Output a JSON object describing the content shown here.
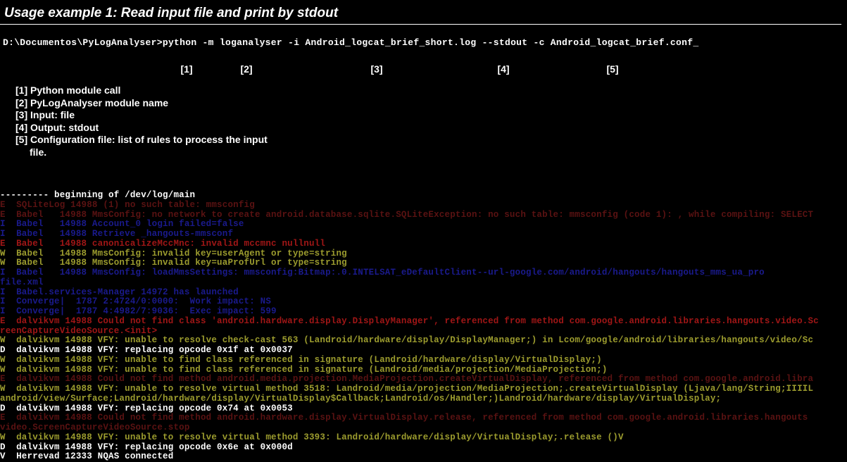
{
  "title": "Usage example 1: Read input file and print by stdout",
  "cmd": {
    "prompt": "D:\\Documentos\\PyLogAnalyser>",
    "part1": "python -m",
    "part2": "loganalyser",
    "part3": "-i Android_logcat_brief_short.log",
    "part4": "--stdout",
    "part5": "-c Android_logcat_brief.conf_"
  },
  "annot": {
    "a1": "[1]",
    "a2": "[2]",
    "a3": "[3]",
    "a4": "[4]",
    "a5": "[5]"
  },
  "legend": {
    "l1": "[1] Python module call",
    "l2": "[2] PyLogAnalyser module name",
    "l3": "[3] Input: file",
    "l4": "[4] Output: stdout",
    "l5": "[5] Configuration file: list of rules to process the input",
    "l5b": "file."
  },
  "log": [
    {
      "c": "c-white",
      "t": "--------- beginning of /dev/log/main"
    },
    {
      "c": "c-darkred",
      "t": "E  SQLiteLog 14988 (1) no such table: mmsconfig"
    },
    {
      "c": "c-darkred",
      "t": "E  Babel   14988 MmsConfig: no network to create android.database.sqlite.SQLiteException: no such table: mmsconfig (code 1): , while compiling: SELECT"
    },
    {
      "c": "c-darkblue",
      "t": "I  Babel   14988 Account_0 login failed=false"
    },
    {
      "c": "c-darkblue",
      "t": "I  Babel   14988 Retrieve _hangouts-mmsconf"
    },
    {
      "c": "c-red",
      "t": "E  Babel   14988 canonicalizeMccMnc: invalid mccmnc nullnull"
    },
    {
      "c": "c-olive",
      "t": "W  Babel   14988 MmsConfig: invalid key=userAgent or type=string"
    },
    {
      "c": "c-olive",
      "t": "W  Babel   14988 MmsConfig: invalid key=uaProfUrl or type=string"
    },
    {
      "c": "c-darkblue",
      "t": "I  Babel   14988 MmsConfig: loadMmsSettings: mmsconfig:Bitmap:.0.INTELSAT_eDefaultClient--url-google.com/android/hangouts/hangouts_mms_ua_pro"
    },
    {
      "c": "c-darkblue",
      "t": "file.xml"
    },
    {
      "c": "c-darkblue",
      "t": "I  Babel.services-Manager 14972 has launched"
    },
    {
      "c": "c-darkblue",
      "t": "I  Converge|  1787 2:4724/0:0000:  Work impact: NS"
    },
    {
      "c": "c-darkblue",
      "t": "I  Converge|  1787 4:4982/7:9036:  Exec impact: 599"
    },
    {
      "c": "c-red",
      "t": "E  dalvikvm 14988 Could not find class 'android.hardware.display.DisplayManager', referenced from method com.google.android.libraries.hangouts.video.Sc"
    },
    {
      "c": "c-red",
      "t": "reenCaptureVideoSource.<init>"
    },
    {
      "c": "c-olive",
      "t": "W  dalvikvm 14988 VFY: unable to resolve check-cast 563 (Landroid/hardware/display/DisplayManager;) in Lcom/google/android/libraries/hangouts/video/Sc"
    },
    {
      "c": "c-white",
      "t": "D  dalvikvm 14988 VFY: replacing opcode 0x1f at 0x0037"
    },
    {
      "c": "c-olive",
      "t": "W  dalvikvm 14988 VFY: unable to find class referenced in signature (Landroid/hardware/display/VirtualDisplay;)"
    },
    {
      "c": "c-olive",
      "t": "W  dalvikvm 14988 VFY: unable to find class referenced in signature (Landroid/media/projection/MediaProjection;)"
    },
    {
      "c": "c-darkred",
      "t": "E  dalvikvm 14988 Could not find method android.media.projection.MediaProjection.createVirtualDisplay, referenced from method com.google.android.libra"
    },
    {
      "c": "c-olive",
      "t": "W  dalvikvm 14988 VFY: unable to resolve virtual method 3518: Landroid/media/projection/MediaProjection;.createVirtualDisplay (Ljava/lang/String;IIIIL"
    },
    {
      "c": "c-olive",
      "t": "android/view/Surface;Landroid/hardware/display/VirtualDisplay$Callback;Landroid/os/Handler;)Landroid/hardware/display/VirtualDisplay;"
    },
    {
      "c": "c-white",
      "t": "D  dalvikvm 14988 VFY: replacing opcode 0x74 at 0x0053"
    },
    {
      "c": "c-darkred",
      "t": "E  dalvikvm 14988 Could not find method android.hardware.display.VirtualDisplay.release, referenced from method com.google.android.libraries.hangouts"
    },
    {
      "c": "c-darkred",
      "t": "video.ScreenCaptureVideoSource.stop"
    },
    {
      "c": "c-olive",
      "t": "W  dalvikvm 14988 VFY: unable to resolve virtual method 3393: Landroid/hardware/display/VirtualDisplay;.release ()V"
    },
    {
      "c": "c-white",
      "t": "D  dalvikvm 14988 VFY: replacing opcode 0x6e at 0x000d"
    },
    {
      "c": "c-white",
      "t": "V  Herrevad 12333 NQAS connected"
    }
  ]
}
